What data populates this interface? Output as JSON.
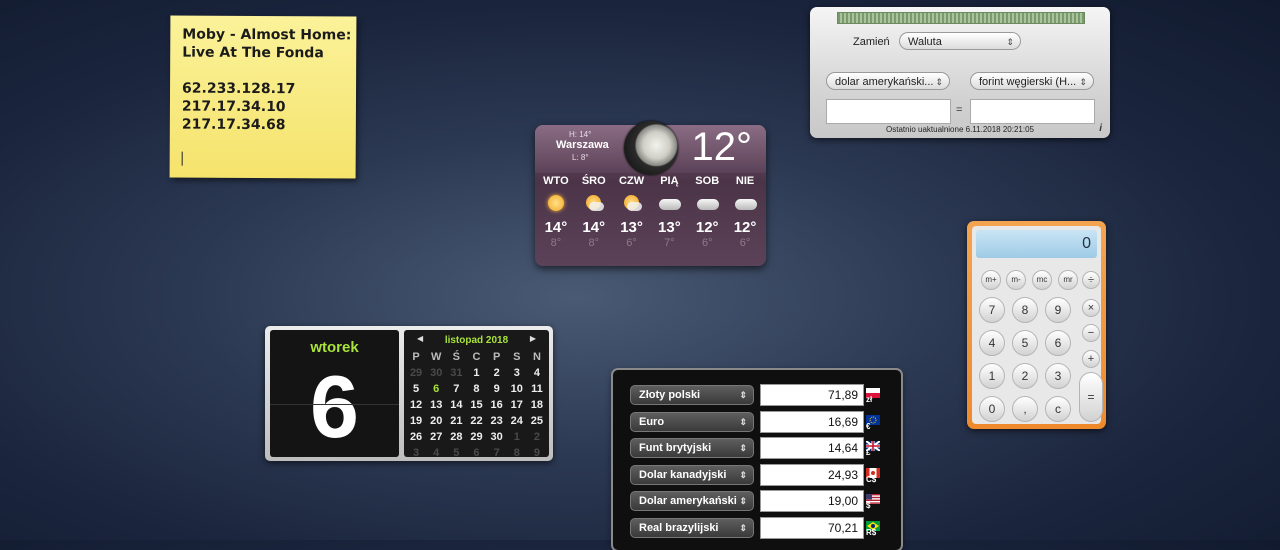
{
  "sticky_note": {
    "lines": "Moby - Almost Home:\nLive At The Fonda\n\n62.233.128.17\n217.17.34.10\n217.17.34.68"
  },
  "weather": {
    "city": "Warszawa",
    "high": "H: 14°",
    "low": "L: 8°",
    "current_temp": "12°",
    "forecast": [
      {
        "day": "WTO",
        "icon": "sunny",
        "hi": "14°",
        "lo": "8°"
      },
      {
        "day": "ŚRO",
        "icon": "partly-sunny",
        "hi": "14°",
        "lo": "8°"
      },
      {
        "day": "CZW",
        "icon": "partly-sunny",
        "hi": "13°",
        "lo": "6°"
      },
      {
        "day": "PIĄ",
        "icon": "cloudy",
        "hi": "13°",
        "lo": "7°"
      },
      {
        "day": "SOB",
        "icon": "cloudy",
        "hi": "12°",
        "lo": "6°"
      },
      {
        "day": "NIE",
        "icon": "cloudy",
        "hi": "12°",
        "lo": "6°"
      }
    ]
  },
  "converter": {
    "convert_label": "Zamień",
    "category": "Waluta",
    "from": "dolar amerykański...",
    "to": "forint węgierski (H...",
    "equals": "=",
    "updated": "Ostatnio uaktualnione 6.11.2018 20:21:05",
    "info": "i"
  },
  "calculator": {
    "display": "0",
    "memory": [
      "m+",
      "m-",
      "mc",
      "mr"
    ],
    "digits": [
      "7",
      "8",
      "9",
      "4",
      "5",
      "6",
      "1",
      "2",
      "3",
      "0",
      ",",
      "c"
    ],
    "ops": [
      "÷",
      "×",
      "−",
      "+",
      "="
    ]
  },
  "date": {
    "weekday": "wtorek",
    "day": "6",
    "month": "listopad 2018",
    "headers": [
      "P",
      "W",
      "Ś",
      "C",
      "P",
      "S",
      "N"
    ],
    "cells": [
      [
        "29",
        "o"
      ],
      [
        "30",
        "o"
      ],
      [
        "31",
        "o"
      ],
      [
        "1",
        ""
      ],
      [
        "2",
        ""
      ],
      [
        "3",
        ""
      ],
      [
        "4",
        ""
      ],
      [
        "5",
        ""
      ],
      [
        "6",
        "t"
      ],
      [
        "7",
        ""
      ],
      [
        "8",
        ""
      ],
      [
        "9",
        ""
      ],
      [
        "10",
        ""
      ],
      [
        "11",
        ""
      ],
      [
        "12",
        ""
      ],
      [
        "13",
        ""
      ],
      [
        "14",
        ""
      ],
      [
        "15",
        ""
      ],
      [
        "16",
        ""
      ],
      [
        "17",
        ""
      ],
      [
        "18",
        ""
      ],
      [
        "19",
        ""
      ],
      [
        "20",
        ""
      ],
      [
        "21",
        ""
      ],
      [
        "22",
        ""
      ],
      [
        "23",
        ""
      ],
      [
        "24",
        ""
      ],
      [
        "25",
        ""
      ],
      [
        "26",
        ""
      ],
      [
        "27",
        ""
      ],
      [
        "28",
        ""
      ],
      [
        "29",
        ""
      ],
      [
        "30",
        ""
      ],
      [
        "1",
        "o"
      ],
      [
        "2",
        "o"
      ],
      [
        "3",
        "o"
      ],
      [
        "4",
        "o"
      ],
      [
        "5",
        "o"
      ],
      [
        "6",
        "o"
      ],
      [
        "7",
        "o"
      ],
      [
        "8",
        "o"
      ],
      [
        "9",
        "o"
      ]
    ]
  },
  "currencies": [
    {
      "name": "Złoty polski",
      "value": "71,89",
      "symbol": "zł",
      "flag": "pl"
    },
    {
      "name": "Euro",
      "value": "16,69",
      "symbol": "€",
      "flag": "eu"
    },
    {
      "name": "Funt brytyjski",
      "value": "14,64",
      "symbol": "£",
      "flag": "gb"
    },
    {
      "name": "Dolar kanadyjski",
      "value": "24,93",
      "symbol": "C$",
      "flag": "ca"
    },
    {
      "name": "Dolar amerykański",
      "value": "19,00",
      "symbol": "$",
      "flag": "us"
    },
    {
      "name": "Real brazylijski",
      "value": "70,21",
      "symbol": "R$",
      "flag": "br"
    }
  ],
  "colors": {
    "calendar_accent": "#a8e33a",
    "calculator_frame": "#ee8a2c",
    "sticky": "#f8ec82"
  }
}
